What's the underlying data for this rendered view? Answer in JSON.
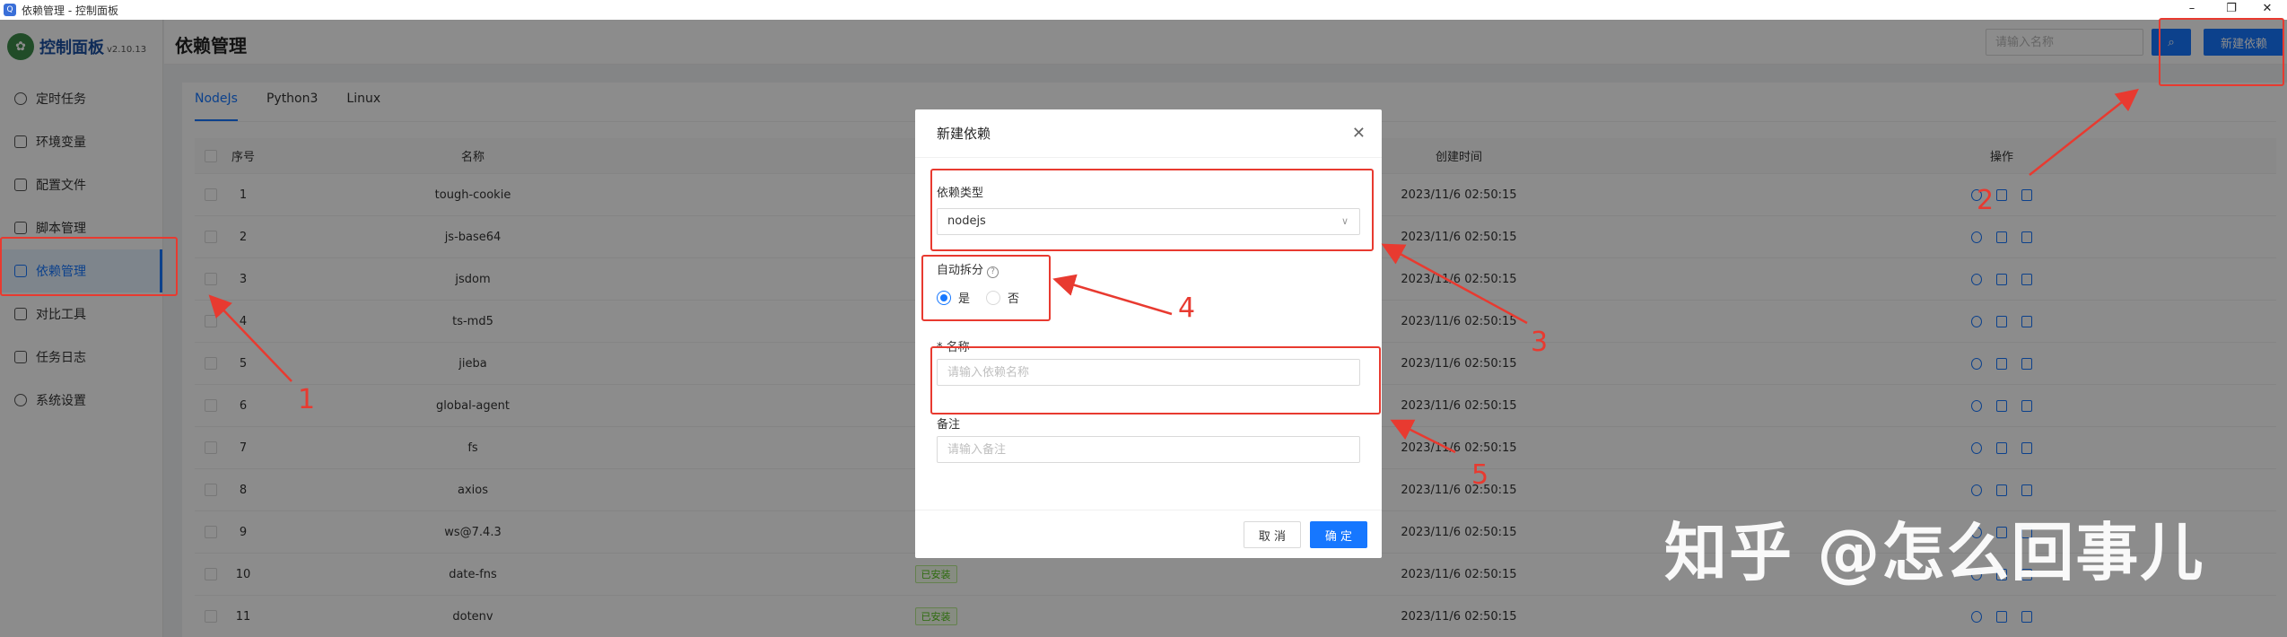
{
  "window": {
    "title": "依赖管理 - 控制面板",
    "controls": [
      "–",
      "❐",
      "✕"
    ]
  },
  "sidebar": {
    "brand": "控制面板",
    "version": "v2.10.13",
    "items": [
      {
        "label": "定时任务",
        "icon": "clock-icon"
      },
      {
        "label": "环境变量",
        "icon": "variable-icon"
      },
      {
        "label": "配置文件",
        "icon": "config-icon"
      },
      {
        "label": "脚本管理",
        "icon": "script-icon"
      },
      {
        "label": "依赖管理",
        "icon": "dependency-icon",
        "active": true
      },
      {
        "label": "对比工具",
        "icon": "diff-icon"
      },
      {
        "label": "任务日志",
        "icon": "folder-icon"
      },
      {
        "label": "系统设置",
        "icon": "gear-icon"
      }
    ]
  },
  "header": {
    "title": "依赖管理",
    "search_placeholder": "请输入名称",
    "new_button": "新建依赖"
  },
  "tabs": [
    "NodeJs",
    "Python3",
    "Linux"
  ],
  "table": {
    "columns": {
      "no": "序号",
      "name": "名称",
      "time": "创建时间",
      "ops": "操作"
    },
    "rows": [
      {
        "no": "1",
        "name": "tough-cookie",
        "time": "2023/11/6 02:50:15"
      },
      {
        "no": "2",
        "name": "js-base64",
        "time": "2023/11/6 02:50:15"
      },
      {
        "no": "3",
        "name": "jsdom",
        "time": "2023/11/6 02:50:15"
      },
      {
        "no": "4",
        "name": "ts-md5",
        "time": "2023/11/6 02:50:15"
      },
      {
        "no": "5",
        "name": "jieba",
        "time": "2023/11/6 02:50:15"
      },
      {
        "no": "6",
        "name": "global-agent",
        "time": "2023/11/6 02:50:15"
      },
      {
        "no": "7",
        "name": "fs",
        "time": "2023/11/6 02:50:15"
      },
      {
        "no": "8",
        "name": "axios",
        "time": "2023/11/6 02:50:15"
      },
      {
        "no": "9",
        "name": "ws@7.4.3",
        "time": "2023/11/6 02:50:15"
      },
      {
        "no": "10",
        "name": "date-fns",
        "status": "已安装",
        "time": "2023/11/6 02:50:15"
      },
      {
        "no": "11",
        "name": "dotenv",
        "status": "已安装",
        "time": "2023/11/6 02:50:15"
      }
    ]
  },
  "modal": {
    "title": "新建依赖",
    "type_label": "依赖类型",
    "type_value": "nodejs",
    "auto_split_label": "自动拆分",
    "yes": "是",
    "no": "否",
    "name_label": "* 名称",
    "name_placeholder": "请输入依赖名称",
    "remark_label": "备注",
    "remark_placeholder": "请输入备注",
    "cancel": "取 消",
    "ok": "确 定"
  },
  "annotations": [
    "1",
    "2",
    "3",
    "4",
    "5"
  ],
  "watermark": "知乎 @怎么回事儿",
  "colors": {
    "accent": "#1677ff",
    "annotation": "#e83a30",
    "installed": "#52c41a"
  }
}
